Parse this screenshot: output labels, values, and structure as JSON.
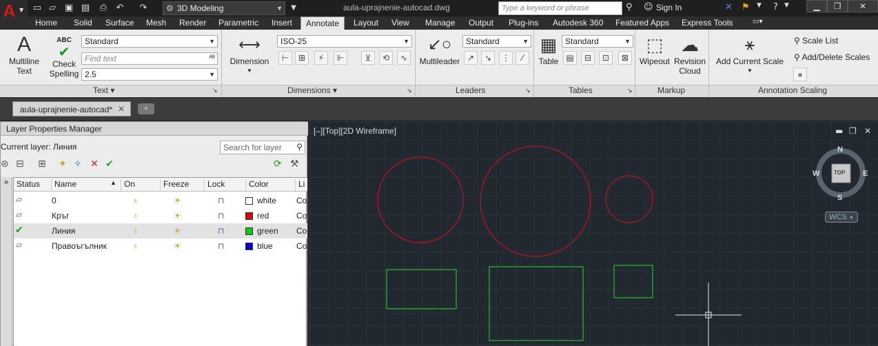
{
  "app": {
    "workspace": "3D Modeling",
    "file_title": "aula-uprajnenie-autocad.dwg",
    "search_placeholder": "Type a keyword or phrase",
    "sign_in": "Sign In",
    "help": "?"
  },
  "tabs": [
    "Home",
    "Solid",
    "Surface",
    "Mesh",
    "Render",
    "Parametric",
    "Insert",
    "Annotate",
    "Layout",
    "View",
    "Manage",
    "Output",
    "Plug-ins",
    "Autodesk 360",
    "Featured Apps",
    "Express Tools"
  ],
  "active_tab": "Annotate",
  "ribbon": {
    "text": {
      "multiline_line1": "Multiline",
      "multiline_line2": "Text",
      "check_line1": "Check",
      "check_line2": "Spelling",
      "style": "Standard",
      "find_placeholder": "Find text",
      "height": "2.5",
      "check_icon": "ABC",
      "panel": "Text"
    },
    "dimensions": {
      "dimension": "Dimension",
      "style": "ISO-25",
      "panel": "Dimensions"
    },
    "leaders": {
      "multileader": "Multileader",
      "style": "Standard",
      "panel": "Leaders"
    },
    "tables": {
      "table": "Table",
      "style": "Standard",
      "panel": "Tables"
    },
    "markup": {
      "wipeout": "Wipeout",
      "revision_line1": "Revision",
      "revision_line2": "Cloud",
      "panel": "Markup"
    },
    "scaling": {
      "add_current": "Add Current Scale",
      "scale_list": "Scale List",
      "add_delete": "Add/Delete Scales",
      "panel": "Annotation Scaling"
    }
  },
  "file_tab": "aula-uprajnenie-autocad*",
  "layers": {
    "title": "Layer Properties Manager",
    "current": "Current layer: Линия",
    "search_placeholder": "Search for layer",
    "headers": [
      "Status",
      "Name",
      "On",
      "Freeze",
      "Lock",
      "Color",
      "Li"
    ],
    "rows": [
      {
        "name": "0",
        "color": "white",
        "hex": "#ffffff",
        "lt": "Co",
        "current": false
      },
      {
        "name": "Кръг",
        "color": "red",
        "hex": "#e00000",
        "lt": "Co",
        "current": false
      },
      {
        "name": "Линия",
        "color": "green",
        "hex": "#00d000",
        "lt": "Co",
        "current": true
      },
      {
        "name": "Правоъгълник",
        "color": "blue",
        "hex": "#0000e0",
        "lt": "Co",
        "current": false
      }
    ]
  },
  "viewport": {
    "label": "[–][Top][2D Wireframe]",
    "cube_top": "TOP",
    "n": "N",
    "s": "S",
    "e": "E",
    "w": "W",
    "wcs": "WCS"
  },
  "colors": {
    "circle": "#e01010",
    "rect": "#20e020",
    "bg": "#212830"
  }
}
